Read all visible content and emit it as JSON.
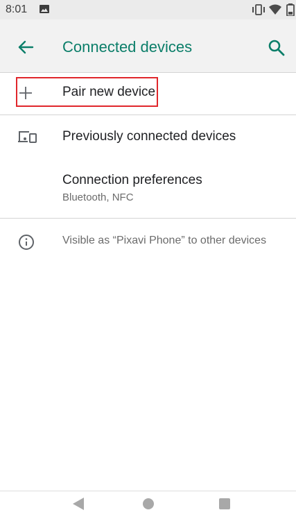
{
  "status_bar": {
    "time": "8:01",
    "icons": [
      "image-icon",
      "vibrate-icon",
      "wifi-icon",
      "battery-icon"
    ]
  },
  "app_bar": {
    "title": "Connected devices",
    "back_icon": "arrow-left-icon",
    "search_icon": "search-icon",
    "accent_color": "#0b7e69"
  },
  "list": {
    "pair_new_device": {
      "label": "Pair new device",
      "icon": "plus-icon"
    },
    "previously_connected": {
      "label": "Previously connected devices",
      "icon": "devices-icon"
    },
    "connection_preferences": {
      "label": "Connection preferences",
      "summary": "Bluetooth, NFC"
    },
    "visibility_info": {
      "text": "Visible as “Pixavi Phone” to other devices",
      "icon": "info-icon"
    }
  },
  "highlight_color": "#e0262b",
  "nav_bar": {
    "buttons": [
      "back-triangle-icon",
      "home-circle-icon",
      "recents-square-icon"
    ]
  }
}
